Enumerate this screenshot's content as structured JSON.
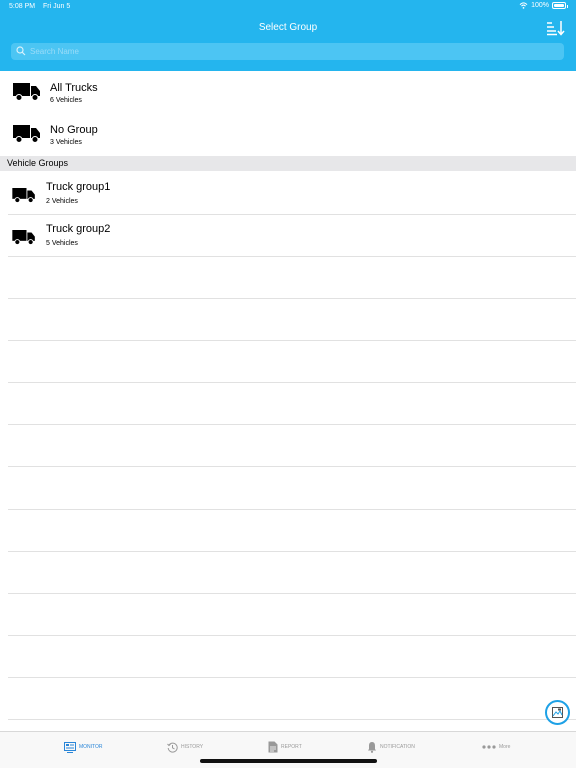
{
  "status_bar": {
    "time": "5:08 PM",
    "date": "Fri Jun 5",
    "battery": "100%",
    "battery_level": 1.0
  },
  "header": {
    "title": "Select Group",
    "sort_icon": "sort-descending-icon"
  },
  "search": {
    "placeholder": "Search Name"
  },
  "groups": [
    {
      "name": "All Trucks",
      "count": "6 Vehicles",
      "icon": "truck-icon"
    },
    {
      "name": "No Group",
      "count": "3 Vehicles",
      "icon": "truck-icon"
    }
  ],
  "vehicle_groups": {
    "section_title": "Vehicle Groups",
    "items": [
      {
        "name": "Truck group1",
        "count": "2 Vehicles",
        "icon": "truck-icon"
      },
      {
        "name": "Truck group2",
        "count": "5 Vehicles",
        "icon": "truck-icon"
      }
    ]
  },
  "tabs": [
    {
      "label": "MONITOR",
      "icon": "monitor-icon",
      "active": true
    },
    {
      "label": "HISTORY",
      "icon": "history-icon",
      "active": false
    },
    {
      "label": "REPORT",
      "icon": "report-icon",
      "active": false
    },
    {
      "label": "NOTIFICATION",
      "icon": "bell-icon",
      "active": false
    },
    {
      "label": "More",
      "icon": "more-icon",
      "active": false
    }
  ],
  "colors": {
    "header": "#24b5ee",
    "active_tab": "#2a86d8",
    "section_bg": "#e7e7e9",
    "fab_border": "#1ea1e6"
  }
}
